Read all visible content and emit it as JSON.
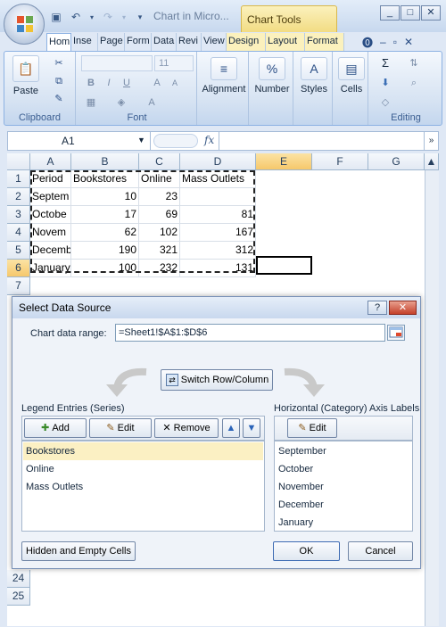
{
  "window": {
    "title": "Chart in Micro...",
    "contextual_tab": "Chart Tools"
  },
  "window_buttons": [
    "_",
    "□",
    "✕"
  ],
  "tabs": [
    "Hom",
    "Inse",
    "Page",
    "Form",
    "Data",
    "Revi",
    "View",
    "Design",
    "Layout",
    "Format"
  ],
  "ribbon": {
    "clipboard": {
      "label": "Clipboard",
      "paste": "Paste"
    },
    "font": {
      "label": "Font",
      "size": "11"
    },
    "alignment": "Alignment",
    "number": "Number",
    "styles": "Styles",
    "cells": "Cells",
    "editing": "Editing"
  },
  "formula_bar": {
    "name_box": "A1",
    "fx": "fx",
    "value": ""
  },
  "grid": {
    "columns": [
      "A",
      "B",
      "C",
      "D",
      "E",
      "F",
      "G"
    ],
    "rows": [
      "1",
      "2",
      "3",
      "4",
      "5",
      "6",
      "7",
      "24",
      "25"
    ],
    "cells": [
      [
        "Period",
        "Bookstores",
        "Online",
        "Mass Outlets"
      ],
      [
        "Septem",
        "10",
        "23",
        ""
      ],
      [
        "Octobe",
        "17",
        "69",
        "81"
      ],
      [
        "Novem",
        "62",
        "102",
        "167"
      ],
      [
        "Decemb",
        "190",
        "321",
        "312"
      ],
      [
        "January",
        "100",
        "232",
        "131"
      ]
    ],
    "active_cell": "E6"
  },
  "dialog": {
    "title": "Select Data Source",
    "help": "?",
    "close": "✕",
    "range_label": "Chart data range:",
    "range_value": "=Sheet1!$A$1:$D$6",
    "switch_button": "Switch Row/Column",
    "legend_label": "Legend Entries (Series)",
    "axis_label": "Horizontal (Category) Axis Labels",
    "legend_buttons": {
      "add": "Add",
      "edit": "Edit",
      "remove": "Remove"
    },
    "axis_edit": "Edit",
    "series": [
      "Bookstores",
      "Online",
      "Mass Outlets"
    ],
    "categories": [
      "September",
      "October",
      "November",
      "December",
      "January"
    ],
    "hidden_button": "Hidden and Empty Cells",
    "ok": "OK",
    "cancel": "Cancel"
  }
}
